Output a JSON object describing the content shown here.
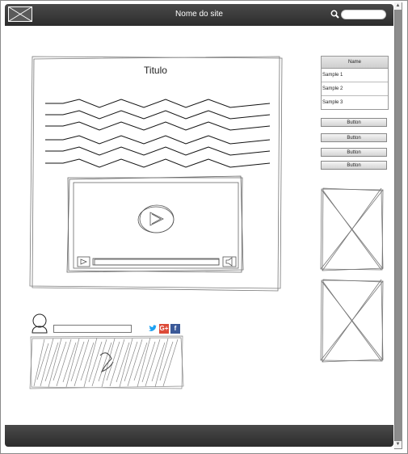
{
  "header": {
    "site_title": "Nome do site",
    "logo_icon": "image-placeholder-icon",
    "search_icon": "search-icon"
  },
  "article": {
    "title": "Titulo"
  },
  "video": {
    "play_icon": "play-icon",
    "volume_icon": "volume-icon"
  },
  "table": {
    "header": "Name",
    "rows": [
      "Sample 1",
      "Sample 2",
      "Sample 3"
    ]
  },
  "buttons": [
    "Button",
    "Button",
    "Button",
    "Button"
  ],
  "social": {
    "twitter_icon": "twitter-icon",
    "google_plus_label": "G+",
    "facebook_label": "f"
  },
  "colors": {
    "bar": "#3a3a3a",
    "twitter": "#1da1f2",
    "google_plus": "#dd4b39",
    "facebook": "#3b5998"
  }
}
